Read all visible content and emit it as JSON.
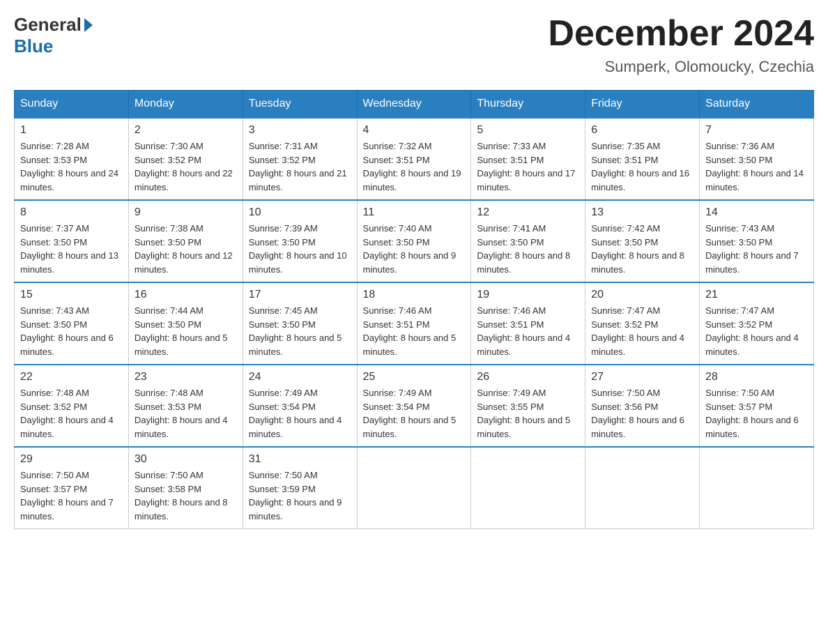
{
  "logo": {
    "general": "General",
    "blue": "Blue"
  },
  "title": "December 2024",
  "subtitle": "Sumperk, Olomoucky, Czechia",
  "days_of_week": [
    "Sunday",
    "Monday",
    "Tuesday",
    "Wednesday",
    "Thursday",
    "Friday",
    "Saturday"
  ],
  "weeks": [
    [
      {
        "day": "1",
        "sunrise": "7:28 AM",
        "sunset": "3:53 PM",
        "daylight": "8 hours and 24 minutes."
      },
      {
        "day": "2",
        "sunrise": "7:30 AM",
        "sunset": "3:52 PM",
        "daylight": "8 hours and 22 minutes."
      },
      {
        "day": "3",
        "sunrise": "7:31 AM",
        "sunset": "3:52 PM",
        "daylight": "8 hours and 21 minutes."
      },
      {
        "day": "4",
        "sunrise": "7:32 AM",
        "sunset": "3:51 PM",
        "daylight": "8 hours and 19 minutes."
      },
      {
        "day": "5",
        "sunrise": "7:33 AM",
        "sunset": "3:51 PM",
        "daylight": "8 hours and 17 minutes."
      },
      {
        "day": "6",
        "sunrise": "7:35 AM",
        "sunset": "3:51 PM",
        "daylight": "8 hours and 16 minutes."
      },
      {
        "day": "7",
        "sunrise": "7:36 AM",
        "sunset": "3:50 PM",
        "daylight": "8 hours and 14 minutes."
      }
    ],
    [
      {
        "day": "8",
        "sunrise": "7:37 AM",
        "sunset": "3:50 PM",
        "daylight": "8 hours and 13 minutes."
      },
      {
        "day": "9",
        "sunrise": "7:38 AM",
        "sunset": "3:50 PM",
        "daylight": "8 hours and 12 minutes."
      },
      {
        "day": "10",
        "sunrise": "7:39 AM",
        "sunset": "3:50 PM",
        "daylight": "8 hours and 10 minutes."
      },
      {
        "day": "11",
        "sunrise": "7:40 AM",
        "sunset": "3:50 PM",
        "daylight": "8 hours and 9 minutes."
      },
      {
        "day": "12",
        "sunrise": "7:41 AM",
        "sunset": "3:50 PM",
        "daylight": "8 hours and 8 minutes."
      },
      {
        "day": "13",
        "sunrise": "7:42 AM",
        "sunset": "3:50 PM",
        "daylight": "8 hours and 8 minutes."
      },
      {
        "day": "14",
        "sunrise": "7:43 AM",
        "sunset": "3:50 PM",
        "daylight": "8 hours and 7 minutes."
      }
    ],
    [
      {
        "day": "15",
        "sunrise": "7:43 AM",
        "sunset": "3:50 PM",
        "daylight": "8 hours and 6 minutes."
      },
      {
        "day": "16",
        "sunrise": "7:44 AM",
        "sunset": "3:50 PM",
        "daylight": "8 hours and 5 minutes."
      },
      {
        "day": "17",
        "sunrise": "7:45 AM",
        "sunset": "3:50 PM",
        "daylight": "8 hours and 5 minutes."
      },
      {
        "day": "18",
        "sunrise": "7:46 AM",
        "sunset": "3:51 PM",
        "daylight": "8 hours and 5 minutes."
      },
      {
        "day": "19",
        "sunrise": "7:46 AM",
        "sunset": "3:51 PM",
        "daylight": "8 hours and 4 minutes."
      },
      {
        "day": "20",
        "sunrise": "7:47 AM",
        "sunset": "3:52 PM",
        "daylight": "8 hours and 4 minutes."
      },
      {
        "day": "21",
        "sunrise": "7:47 AM",
        "sunset": "3:52 PM",
        "daylight": "8 hours and 4 minutes."
      }
    ],
    [
      {
        "day": "22",
        "sunrise": "7:48 AM",
        "sunset": "3:52 PM",
        "daylight": "8 hours and 4 minutes."
      },
      {
        "day": "23",
        "sunrise": "7:48 AM",
        "sunset": "3:53 PM",
        "daylight": "8 hours and 4 minutes."
      },
      {
        "day": "24",
        "sunrise": "7:49 AM",
        "sunset": "3:54 PM",
        "daylight": "8 hours and 4 minutes."
      },
      {
        "day": "25",
        "sunrise": "7:49 AM",
        "sunset": "3:54 PM",
        "daylight": "8 hours and 5 minutes."
      },
      {
        "day": "26",
        "sunrise": "7:49 AM",
        "sunset": "3:55 PM",
        "daylight": "8 hours and 5 minutes."
      },
      {
        "day": "27",
        "sunrise": "7:50 AM",
        "sunset": "3:56 PM",
        "daylight": "8 hours and 6 minutes."
      },
      {
        "day": "28",
        "sunrise": "7:50 AM",
        "sunset": "3:57 PM",
        "daylight": "8 hours and 6 minutes."
      }
    ],
    [
      {
        "day": "29",
        "sunrise": "7:50 AM",
        "sunset": "3:57 PM",
        "daylight": "8 hours and 7 minutes."
      },
      {
        "day": "30",
        "sunrise": "7:50 AM",
        "sunset": "3:58 PM",
        "daylight": "8 hours and 8 minutes."
      },
      {
        "day": "31",
        "sunrise": "7:50 AM",
        "sunset": "3:59 PM",
        "daylight": "8 hours and 9 minutes."
      },
      null,
      null,
      null,
      null
    ]
  ]
}
